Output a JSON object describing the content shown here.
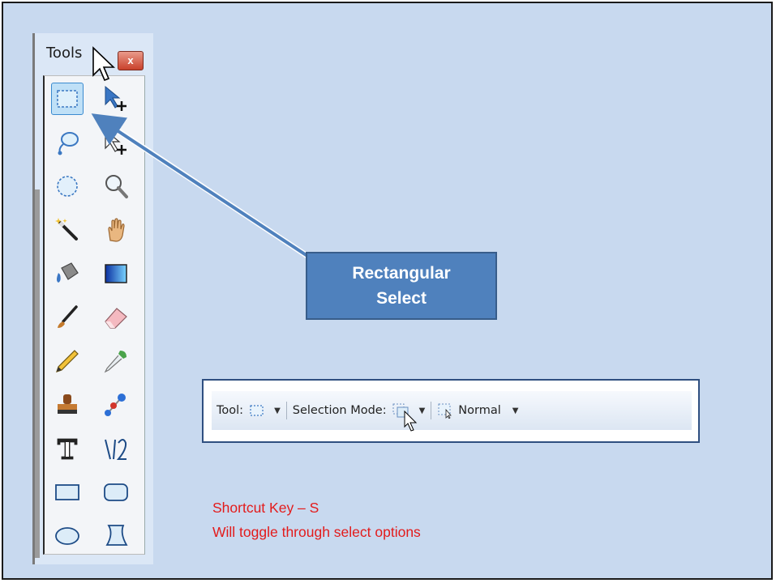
{
  "tools_window": {
    "title": "Tools",
    "close_glyph": "x"
  },
  "tools": [
    {
      "name": "rectangle-select-icon",
      "active": true
    },
    {
      "name": "move-selected-pixels-icon"
    },
    {
      "name": "lasso-select-icon"
    },
    {
      "name": "move-selection-icon"
    },
    {
      "name": "ellipse-select-icon"
    },
    {
      "name": "zoom-icon"
    },
    {
      "name": "magic-wand-icon"
    },
    {
      "name": "pan-hand-icon"
    },
    {
      "name": "paint-bucket-icon"
    },
    {
      "name": "gradient-icon"
    },
    {
      "name": "paintbrush-icon"
    },
    {
      "name": "eraser-icon"
    },
    {
      "name": "pencil-icon"
    },
    {
      "name": "color-picker-icon"
    },
    {
      "name": "clone-stamp-icon"
    },
    {
      "name": "recolor-icon"
    },
    {
      "name": "text-icon"
    },
    {
      "name": "line-curve-icon"
    },
    {
      "name": "rectangle-shape-icon"
    },
    {
      "name": "rounded-rectangle-icon"
    },
    {
      "name": "ellipse-shape-icon"
    },
    {
      "name": "freeform-shape-icon"
    }
  ],
  "callout": {
    "line1": "Rectangular",
    "line2": "Select"
  },
  "toolbar": {
    "tool_label": "Tool:",
    "selection_mode_label": "Selection Mode:",
    "mode_value": "Normal"
  },
  "notes": {
    "line1": "Shortcut Key – S",
    "line2": "Will toggle through select options"
  },
  "colors": {
    "slide_bg": "#c8d9ef",
    "callout_bg": "#4f81bd",
    "arrow": "#4f81bd",
    "note_text": "#e31b1b"
  }
}
